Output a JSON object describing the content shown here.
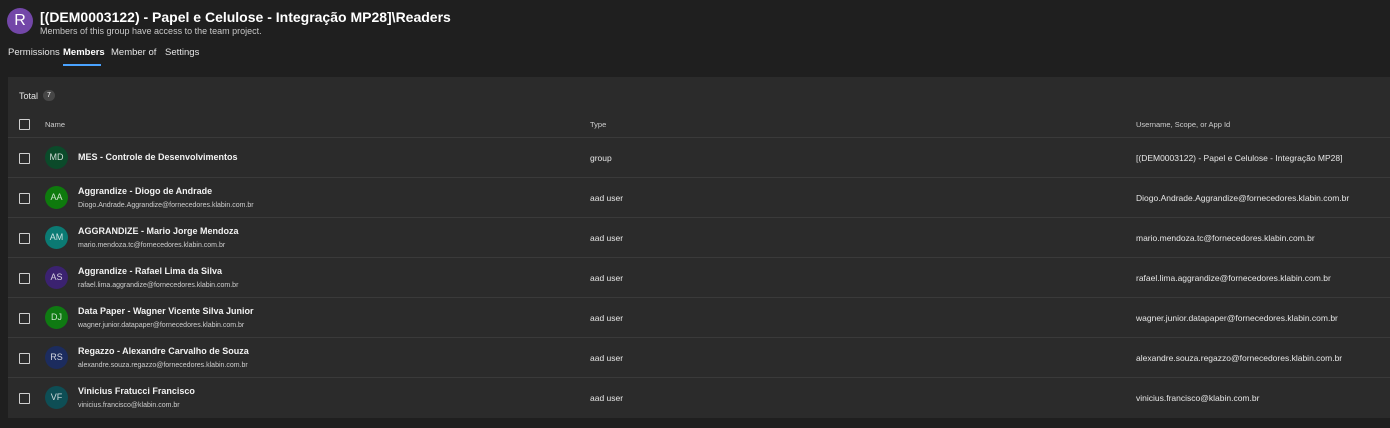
{
  "header": {
    "avatar_letter": "R",
    "title": "[(DEM0003122) - Papel e Celulose - Integração MP28]\\Readers",
    "subtitle": "Members of this group have access to the team project."
  },
  "tabs": [
    {
      "label": "Permissions"
    },
    {
      "label": "Members",
      "active": true
    },
    {
      "label": "Member of"
    },
    {
      "label": "Settings"
    }
  ],
  "table": {
    "total_label": "Total",
    "total_count": "7",
    "columns": {
      "name": "Name",
      "type": "Type",
      "username": "Username, Scope, or App Id"
    },
    "rows": [
      {
        "initials": "MD",
        "avatar_color": "#0b4a2a",
        "name": "MES - Controle de Desenvolvimentos",
        "email": "",
        "type": "group",
        "username": "[(DEM0003122) - Papel e Celulose - Integração MP28]"
      },
      {
        "initials": "AA",
        "avatar_color": "#0e7a0d",
        "name": "Aggrandize - Diogo de Andrade",
        "email": "Diogo.Andrade.Aggrandize@fornecedores.klabin.com.br",
        "type": "aad user",
        "username": "Diogo.Andrade.Aggrandize@fornecedores.klabin.com.br"
      },
      {
        "initials": "AM",
        "avatar_color": "#0b7a73",
        "name": "AGGRANDIZE - Mario Jorge Mendoza",
        "email": "mario.mendoza.tc@fornecedores.klabin.com.br",
        "type": "aad user",
        "username": "mario.mendoza.tc@fornecedores.klabin.com.br"
      },
      {
        "initials": "AS",
        "avatar_color": "#3b2270",
        "name": "Aggrandize - Rafael Lima da Silva",
        "email": "rafael.lima.aggrandize@fornecedores.klabin.com.br",
        "type": "aad user",
        "username": "rafael.lima.aggrandize@fornecedores.klabin.com.br"
      },
      {
        "initials": "DJ",
        "avatar_color": "#0f7a12",
        "name": "Data Paper - Wagner Vicente Silva Junior",
        "email": "wagner.junior.datapaper@fornecedores.klabin.com.br",
        "type": "aad user",
        "username": "wagner.junior.datapaper@fornecedores.klabin.com.br"
      },
      {
        "initials": "RS",
        "avatar_color": "#1c2c5e",
        "name": "Regazzo - Alexandre Carvalho de Souza",
        "email": "alexandre.souza.regazzo@fornecedores.klabin.com.br",
        "type": "aad user",
        "username": "alexandre.souza.regazzo@fornecedores.klabin.com.br"
      },
      {
        "initials": "VF",
        "avatar_color": "#0e4e55",
        "name": "Vinicius Fratucci Francisco",
        "email": "vinicius.francisco@klabin.com.br",
        "type": "aad user",
        "username": "vinicius.francisco@klabin.com.br"
      }
    ]
  }
}
